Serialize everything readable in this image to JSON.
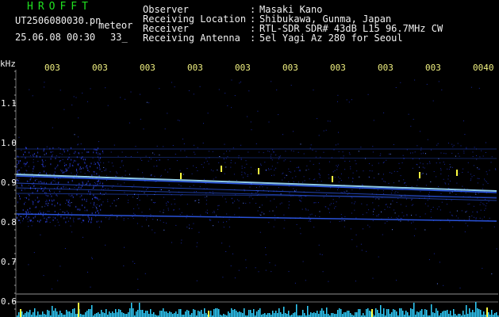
{
  "header": {
    "app_title": "HROFFT",
    "filename": "UT2506080030.pn",
    "file_subtitle": "meteor",
    "date_time": "25.06.08 00:30",
    "count": "33_"
  },
  "info": [
    {
      "label": "Observer",
      "value": "Masaki Kano"
    },
    {
      "label": "Receiving Location",
      "value": "Shibukawa, Gunma, Japan"
    },
    {
      "label": "Receiver",
      "value": "RTL-SDR SDR# 43dB L15 96.7MHz CW"
    },
    {
      "label": "Receiving Antenna",
      "value": "5el Yagi Az 280 for Seoul"
    }
  ],
  "spectrogram": {
    "unit_label": "kHz",
    "time_ticks": [
      "003",
      "003",
      "003",
      "003",
      "003",
      "003",
      "003",
      "003",
      "003",
      "0040"
    ],
    "freq_ticks": [
      "1.1",
      "1.0",
      "0.9",
      "0.8",
      "0.7",
      "0.6"
    ],
    "colors": {
      "background": "#000000",
      "signal": "#3060ff",
      "bright_signal": "#9fe0ff",
      "ping": "#ffff40",
      "level_bar": "#30d0ff",
      "grid_line": "#909090"
    }
  }
}
